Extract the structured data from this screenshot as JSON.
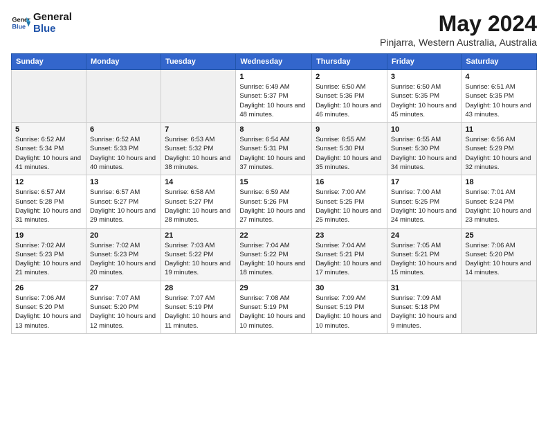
{
  "logo": {
    "line1": "General",
    "line2": "Blue"
  },
  "title": "May 2024",
  "subtitle": "Pinjarra, Western Australia, Australia",
  "headers": [
    "Sunday",
    "Monday",
    "Tuesday",
    "Wednesday",
    "Thursday",
    "Friday",
    "Saturday"
  ],
  "weeks": [
    [
      {
        "day": "",
        "info": ""
      },
      {
        "day": "",
        "info": ""
      },
      {
        "day": "",
        "info": ""
      },
      {
        "day": "1",
        "info": "Sunrise: 6:49 AM\nSunset: 5:37 PM\nDaylight: 10 hours and 48 minutes."
      },
      {
        "day": "2",
        "info": "Sunrise: 6:50 AM\nSunset: 5:36 PM\nDaylight: 10 hours and 46 minutes."
      },
      {
        "day": "3",
        "info": "Sunrise: 6:50 AM\nSunset: 5:35 PM\nDaylight: 10 hours and 45 minutes."
      },
      {
        "day": "4",
        "info": "Sunrise: 6:51 AM\nSunset: 5:35 PM\nDaylight: 10 hours and 43 minutes."
      }
    ],
    [
      {
        "day": "5",
        "info": "Sunrise: 6:52 AM\nSunset: 5:34 PM\nDaylight: 10 hours and 41 minutes."
      },
      {
        "day": "6",
        "info": "Sunrise: 6:52 AM\nSunset: 5:33 PM\nDaylight: 10 hours and 40 minutes."
      },
      {
        "day": "7",
        "info": "Sunrise: 6:53 AM\nSunset: 5:32 PM\nDaylight: 10 hours and 38 minutes."
      },
      {
        "day": "8",
        "info": "Sunrise: 6:54 AM\nSunset: 5:31 PM\nDaylight: 10 hours and 37 minutes."
      },
      {
        "day": "9",
        "info": "Sunrise: 6:55 AM\nSunset: 5:30 PM\nDaylight: 10 hours and 35 minutes."
      },
      {
        "day": "10",
        "info": "Sunrise: 6:55 AM\nSunset: 5:30 PM\nDaylight: 10 hours and 34 minutes."
      },
      {
        "day": "11",
        "info": "Sunrise: 6:56 AM\nSunset: 5:29 PM\nDaylight: 10 hours and 32 minutes."
      }
    ],
    [
      {
        "day": "12",
        "info": "Sunrise: 6:57 AM\nSunset: 5:28 PM\nDaylight: 10 hours and 31 minutes."
      },
      {
        "day": "13",
        "info": "Sunrise: 6:57 AM\nSunset: 5:27 PM\nDaylight: 10 hours and 29 minutes."
      },
      {
        "day": "14",
        "info": "Sunrise: 6:58 AM\nSunset: 5:27 PM\nDaylight: 10 hours and 28 minutes."
      },
      {
        "day": "15",
        "info": "Sunrise: 6:59 AM\nSunset: 5:26 PM\nDaylight: 10 hours and 27 minutes."
      },
      {
        "day": "16",
        "info": "Sunrise: 7:00 AM\nSunset: 5:25 PM\nDaylight: 10 hours and 25 minutes."
      },
      {
        "day": "17",
        "info": "Sunrise: 7:00 AM\nSunset: 5:25 PM\nDaylight: 10 hours and 24 minutes."
      },
      {
        "day": "18",
        "info": "Sunrise: 7:01 AM\nSunset: 5:24 PM\nDaylight: 10 hours and 23 minutes."
      }
    ],
    [
      {
        "day": "19",
        "info": "Sunrise: 7:02 AM\nSunset: 5:23 PM\nDaylight: 10 hours and 21 minutes."
      },
      {
        "day": "20",
        "info": "Sunrise: 7:02 AM\nSunset: 5:23 PM\nDaylight: 10 hours and 20 minutes."
      },
      {
        "day": "21",
        "info": "Sunrise: 7:03 AM\nSunset: 5:22 PM\nDaylight: 10 hours and 19 minutes."
      },
      {
        "day": "22",
        "info": "Sunrise: 7:04 AM\nSunset: 5:22 PM\nDaylight: 10 hours and 18 minutes."
      },
      {
        "day": "23",
        "info": "Sunrise: 7:04 AM\nSunset: 5:21 PM\nDaylight: 10 hours and 17 minutes."
      },
      {
        "day": "24",
        "info": "Sunrise: 7:05 AM\nSunset: 5:21 PM\nDaylight: 10 hours and 15 minutes."
      },
      {
        "day": "25",
        "info": "Sunrise: 7:06 AM\nSunset: 5:20 PM\nDaylight: 10 hours and 14 minutes."
      }
    ],
    [
      {
        "day": "26",
        "info": "Sunrise: 7:06 AM\nSunset: 5:20 PM\nDaylight: 10 hours and 13 minutes."
      },
      {
        "day": "27",
        "info": "Sunrise: 7:07 AM\nSunset: 5:20 PM\nDaylight: 10 hours and 12 minutes."
      },
      {
        "day": "28",
        "info": "Sunrise: 7:07 AM\nSunset: 5:19 PM\nDaylight: 10 hours and 11 minutes."
      },
      {
        "day": "29",
        "info": "Sunrise: 7:08 AM\nSunset: 5:19 PM\nDaylight: 10 hours and 10 minutes."
      },
      {
        "day": "30",
        "info": "Sunrise: 7:09 AM\nSunset: 5:19 PM\nDaylight: 10 hours and 10 minutes."
      },
      {
        "day": "31",
        "info": "Sunrise: 7:09 AM\nSunset: 5:18 PM\nDaylight: 10 hours and 9 minutes."
      },
      {
        "day": "",
        "info": ""
      }
    ]
  ]
}
